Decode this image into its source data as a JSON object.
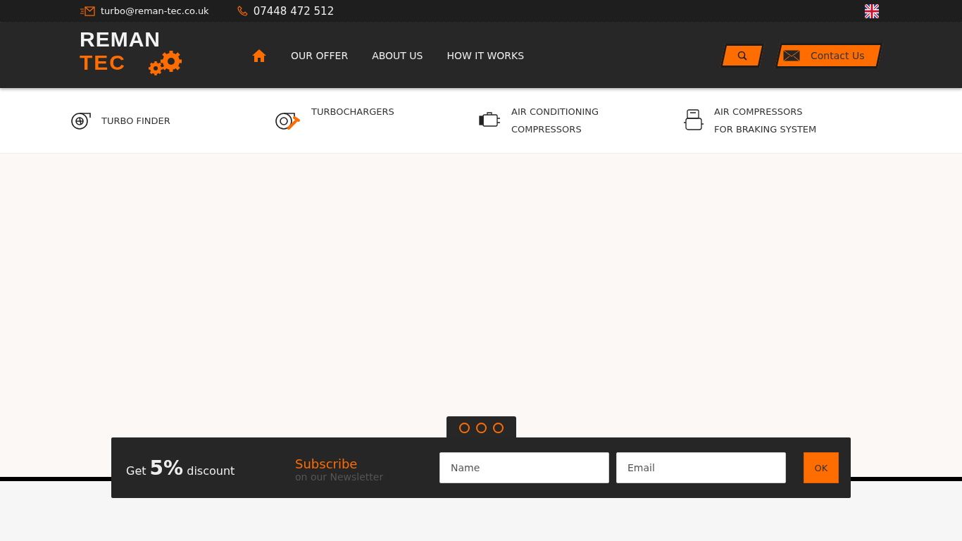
{
  "top_bar": {
    "email": "turbo@reman-tec.co.uk",
    "phone": "07448 472 512"
  },
  "logo": {
    "line_1": "REMAN",
    "line_2": "TEC"
  },
  "nav": {
    "items": [
      "OUR OFFER",
      "ABOUT US",
      "HOW IT WORKS"
    ],
    "contact_button": "Contact Us"
  },
  "categories": [
    {
      "kind": "turbo",
      "lines": [
        "TURBO FINDER"
      ]
    },
    {
      "kind": "wrench",
      "lines": [
        "TURBOCHARGERS"
      ]
    },
    {
      "kind": "ac",
      "lines": [
        "AIR CONDITIONING",
        "COMPRESSORS"
      ]
    },
    {
      "kind": "compressor",
      "lines": [
        "AIR COMPRESSORS",
        "FOR BRAKING SYSTEM"
      ]
    }
  ],
  "slider": {
    "dots": [
      {
        "selected": false
      },
      {
        "selected": false
      },
      {
        "selected": false
      }
    ]
  },
  "newsletter": {
    "discount": "Get **5%** discount",
    "title": "Subscribe",
    "subtitle": "on our Newsletter",
    "name_placeholder": "Name",
    "email_placeholder": "Email",
    "button": "OK"
  }
}
